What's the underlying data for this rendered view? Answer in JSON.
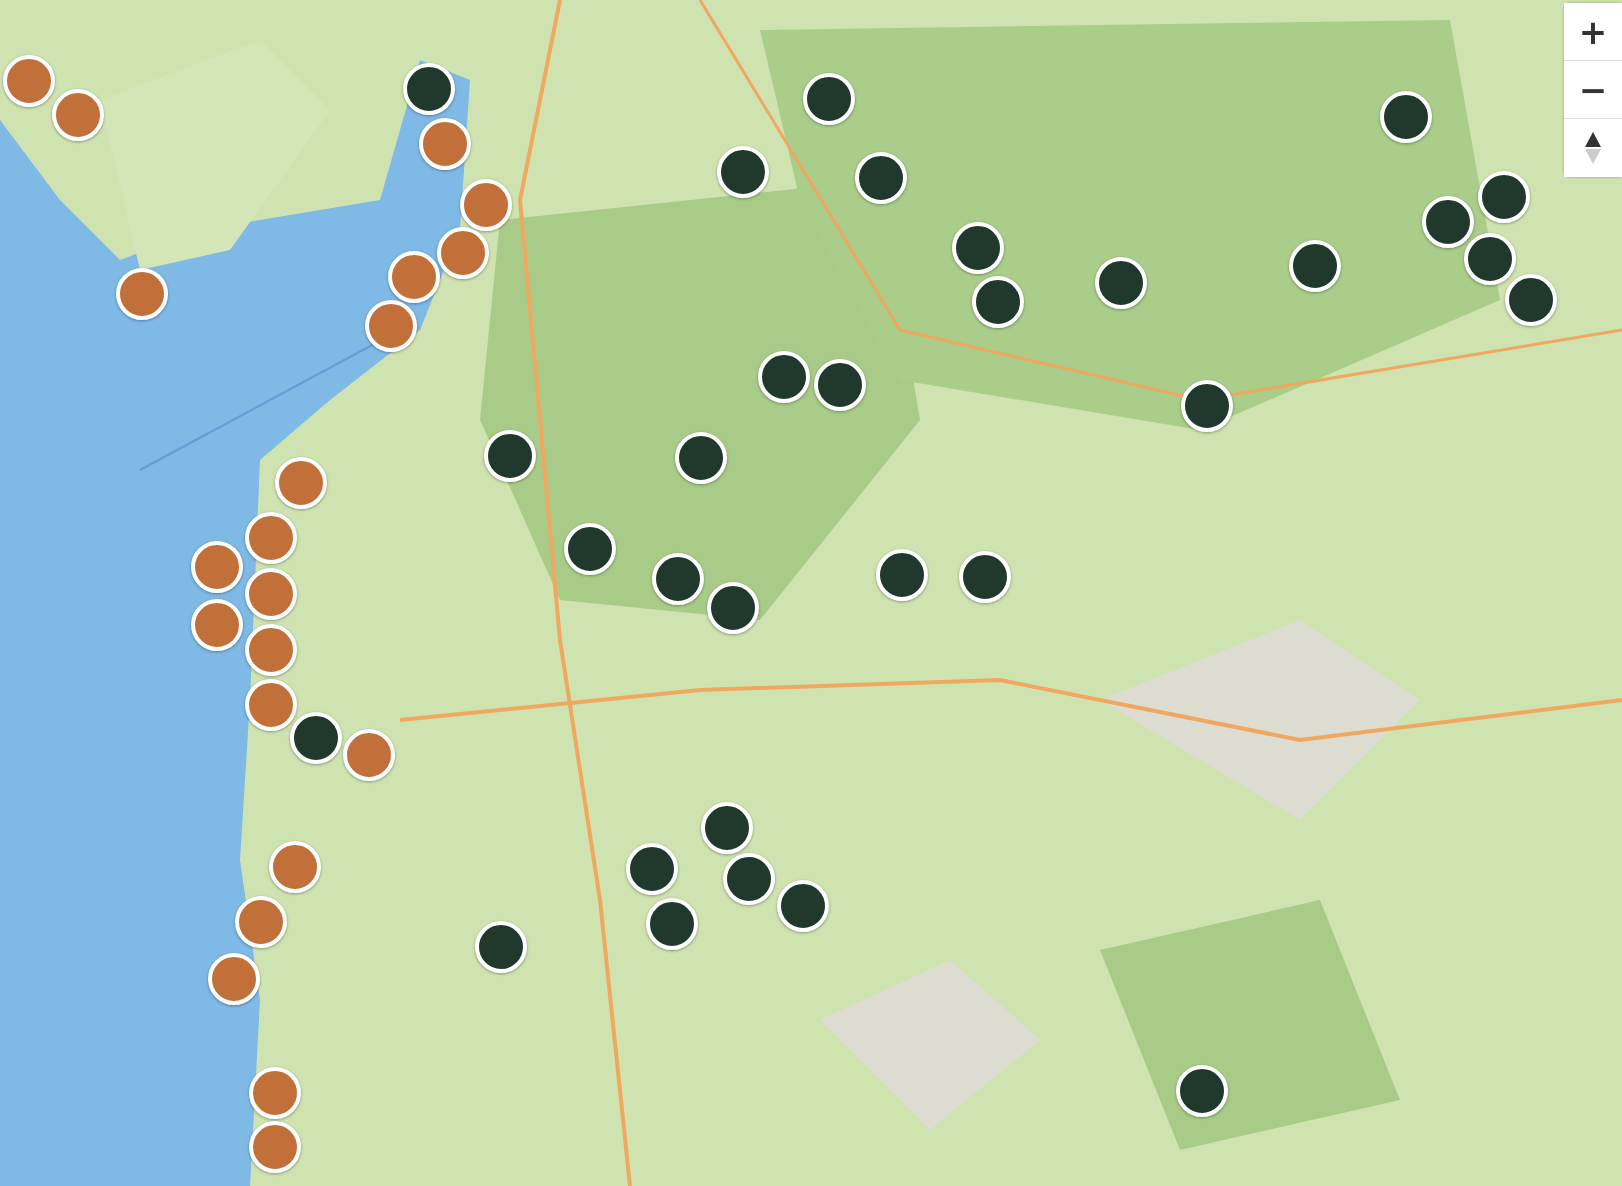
{
  "zoom_controls": [
    {
      "label": "+"
    },
    {
      "label": "−"
    }
  ],
  "markers": [
    {
      "color": "#21392c"
    },
    {
      "color": "#21392c"
    },
    {
      "color": "#c2703a"
    },
    {
      "color": "#c2703a"
    },
    {
      "color": "#c2703a"
    },
    {
      "color": "#c2703a"
    },
    {
      "color": "#c2703a"
    },
    {
      "color": "#c2703a"
    },
    {
      "color": "#c2703a"
    },
    {
      "color": "#c2703a"
    },
    {
      "color": "#c2703a"
    },
    {
      "color": "#c2703a"
    },
    {
      "color": "#c2703a"
    },
    {
      "color": "#c2703a"
    },
    {
      "color": "#c2703a"
    },
    {
      "color": "#c2703a"
    },
    {
      "color": "#c2703a"
    },
    {
      "color": "#c2703a"
    },
    {
      "color": "#c2703a"
    },
    {
      "color": "#c2703a"
    },
    {
      "color": "#c2703a"
    },
    {
      "color": "#c2703a"
    },
    {
      "color": "#c2703a"
    },
    {
      "color": "#21392c"
    },
    {
      "color": "#21392c"
    },
    {
      "color": "#21392c"
    },
    {
      "color": "#21392c"
    },
    {
      "color": "#21392c"
    },
    {
      "color": "#21392c"
    },
    {
      "color": "#21392c"
    },
    {
      "color": "#21392c"
    },
    {
      "color": "#21392c"
    },
    {
      "color": "#21392c"
    },
    {
      "color": "#21392c"
    },
    {
      "color": "#21392c"
    },
    {
      "color": "#21392c"
    },
    {
      "color": "#21392c"
    },
    {
      "color": "#21392c"
    },
    {
      "color": "#21392c"
    },
    {
      "color": "#21392c"
    },
    {
      "color": "#21392c"
    },
    {
      "color": "#21392c"
    },
    {
      "color": "#21392c"
    },
    {
      "color": "#21392c"
    },
    {
      "color": "#21392c"
    },
    {
      "color": "#21392c"
    },
    {
      "color": "#21392c"
    },
    {
      "color": "#21392c"
    },
    {
      "color": "#21392c"
    },
    {
      "color": "#21392c"
    },
    {
      "color": "#21392c"
    },
    {
      "color": "#21392c"
    }
  ]
}
